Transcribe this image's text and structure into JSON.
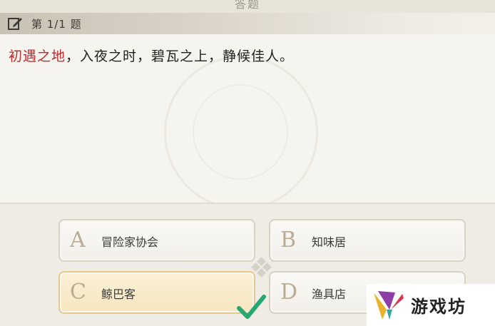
{
  "header": {
    "title": "答题"
  },
  "question": {
    "number": "第 1/1 题",
    "highlight": "初遇之地",
    "text_rest": "，入夜之时，碧瓦之上，静候佳人。"
  },
  "options": [
    {
      "letter": "A",
      "label": "冒险家协会",
      "selected": false
    },
    {
      "letter": "B",
      "label": "知味居",
      "selected": false
    },
    {
      "letter": "C",
      "label": "鲸巴客",
      "selected": true
    },
    {
      "letter": "D",
      "label": "渔具店",
      "selected": false
    }
  ],
  "icons": {
    "edit": "edit-icon",
    "check": "checkmark-icon",
    "logo": "yx-logo-icon"
  },
  "watermark": {
    "text": "游戏坊"
  },
  "colors": {
    "highlight": "#c1272d",
    "selected_bg": "#f8ecd0",
    "check": "#27a870"
  }
}
